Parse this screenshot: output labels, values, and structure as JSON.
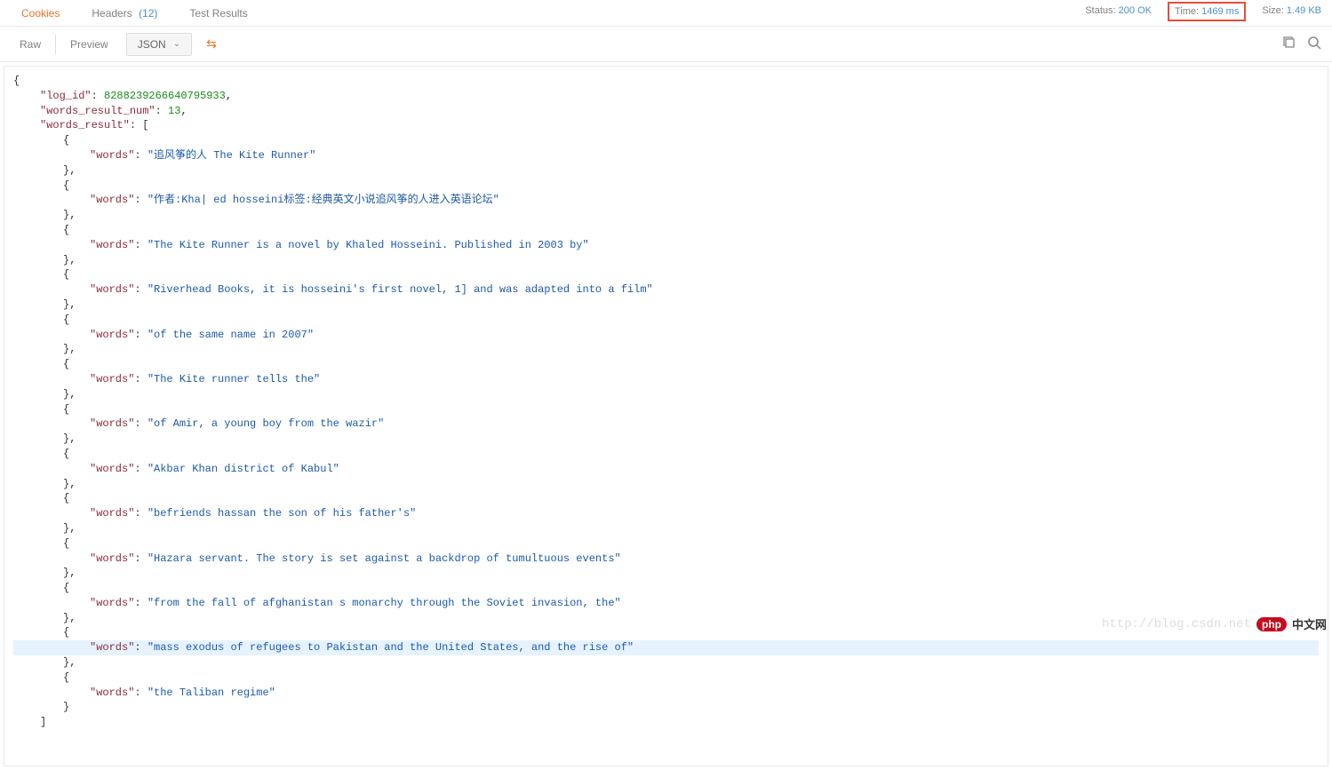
{
  "tabs": {
    "cookies": "Cookies",
    "headers": "Headers",
    "headers_count": "(12)",
    "test_results": "Test Results"
  },
  "status": {
    "status_label": "Status:",
    "status_value": "200 OK",
    "time_label": "Time:",
    "time_value": "1469 ms",
    "size_label": "Size:",
    "size_value": "1.49 KB"
  },
  "toolbar": {
    "raw": "Raw",
    "preview": "Preview",
    "json": "JSON"
  },
  "response": {
    "log_id_key": "\"log_id\"",
    "log_id_val": "8288239266640795933",
    "words_result_num_key": "\"words_result_num\"",
    "words_result_num_val": "13",
    "words_result_key": "\"words_result\"",
    "words_key": "\"words\"",
    "items": [
      "\"追风筝的人 The Kite Runner\"",
      "\"作者:Kha| ed hosseini标签:经典英文小说追风筝的人进入英语论坛\"",
      "\"The Kite Runner is a novel by Khaled Hosseini. Published in 2003 by\"",
      "\"Riverhead Books, it is hosseini's first novel, 1] and was adapted into a film\"",
      "\"of the same name in 2007\"",
      "\"The Kite runner tells the\"",
      "\"of Amir, a young boy from the wazir\"",
      "\"Akbar Khan district of Kabul\"",
      "\"befriends hassan the son of his father's\"",
      "\"Hazara servant. The story is set against a backdrop of tumultuous events\"",
      "\"from the fall of afghanistan s monarchy through the Soviet invasion, the\"",
      "\"mass exodus of refugees to Pakistan and the United States, and the rise of\"",
      "\"the Taliban regime\""
    ],
    "highlight_index": 11
  },
  "watermark": {
    "url": "http://blog.csdn.net",
    "php": "php",
    "cn": "中文网"
  }
}
